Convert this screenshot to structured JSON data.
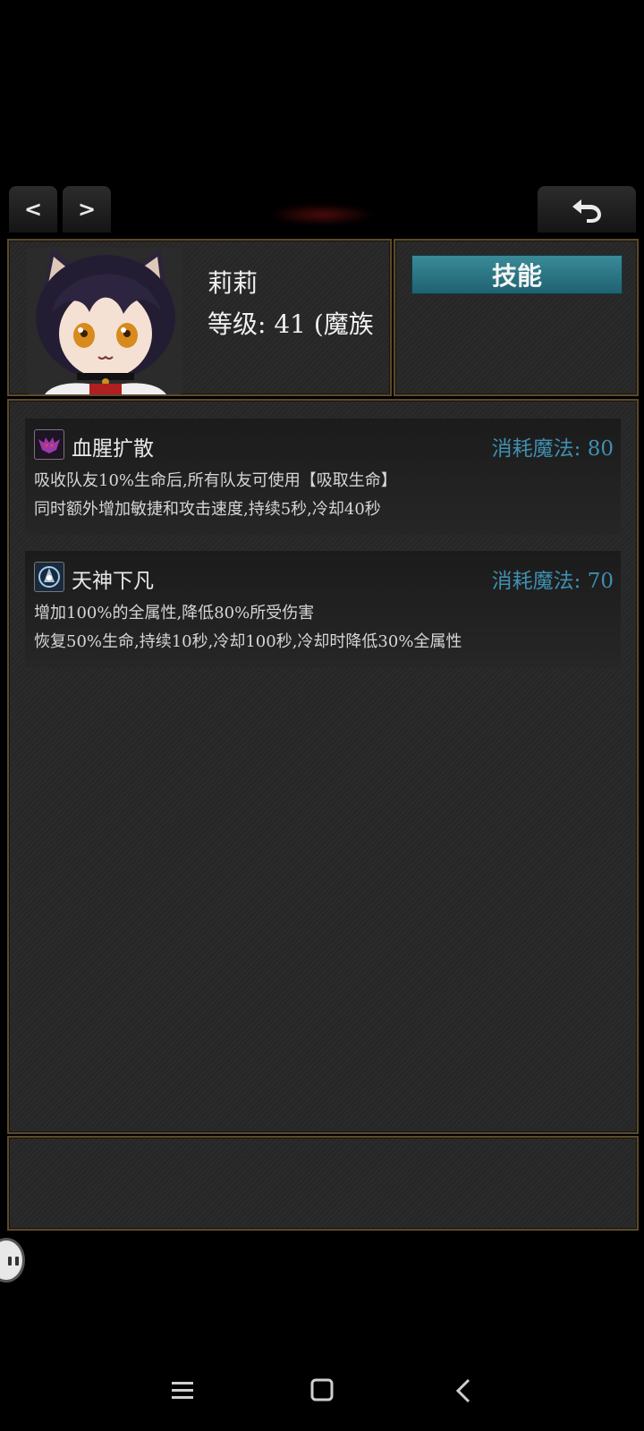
{
  "nav": {
    "prev_label": "<",
    "next_label": ">",
    "back_icon": "undo-arrow-icon"
  },
  "character": {
    "name": "莉莉",
    "level_text": "等级: 41 (魔族"
  },
  "tabs": {
    "skill_label": "技能"
  },
  "skills": [
    {
      "name": "血腥扩散",
      "cost": "消耗魔法: 80",
      "desc_line1": "吸收队友10%生命后,所有队友可使用【吸取生命】",
      "desc_line2": "同时额外增加敏捷和攻击速度,持续5秒,冷却40秒",
      "icon": "blood-bat-icon"
    },
    {
      "name": "天神下凡",
      "cost": "消耗魔法: 70",
      "desc_line1": "增加100%的全属性,降低80%所受伤害",
      "desc_line2": "恢复50%生命,持续10秒,冷却100秒,冷却时降低30%全属性",
      "icon": "divine-descent-icon"
    }
  ],
  "colors": {
    "accent": "#3f8fb0",
    "border": "#5a4a2c",
    "tab": "#2a7886"
  }
}
